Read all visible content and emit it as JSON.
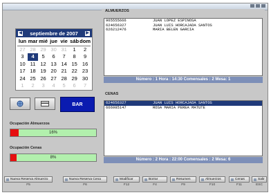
{
  "calendar": {
    "month_year": "septiembre de 2007",
    "prev_icon": "chevron-left-icon",
    "next_icon": "chevron-right-icon",
    "day_names": [
      "lun",
      "mar",
      "mié",
      "jue",
      "vie",
      "sáb",
      "dom"
    ],
    "weeks": [
      [
        {
          "d": "27",
          "o": 1
        },
        {
          "d": "28",
          "o": 1
        },
        {
          "d": "29",
          "o": 1
        },
        {
          "d": "30",
          "o": 1
        },
        {
          "d": "31",
          "o": 1
        },
        {
          "d": "1",
          "o": 0
        },
        {
          "d": "2",
          "o": 0
        }
      ],
      [
        {
          "d": "3",
          "o": 0
        },
        {
          "d": "4",
          "o": 0,
          "today": 1
        },
        {
          "d": "5",
          "o": 0
        },
        {
          "d": "6",
          "o": 0
        },
        {
          "d": "7",
          "o": 0
        },
        {
          "d": "8",
          "o": 0
        },
        {
          "d": "9",
          "o": 0
        }
      ],
      [
        {
          "d": "10",
          "o": 0
        },
        {
          "d": "11",
          "o": 0
        },
        {
          "d": "12",
          "o": 0
        },
        {
          "d": "13",
          "o": 0
        },
        {
          "d": "14",
          "o": 0
        },
        {
          "d": "15",
          "o": 0
        },
        {
          "d": "16",
          "o": 0
        }
      ],
      [
        {
          "d": "17",
          "o": 0
        },
        {
          "d": "18",
          "o": 0
        },
        {
          "d": "19",
          "o": 0
        },
        {
          "d": "20",
          "o": 0
        },
        {
          "d": "21",
          "o": 0
        },
        {
          "d": "22",
          "o": 0
        },
        {
          "d": "23",
          "o": 0
        }
      ],
      [
        {
          "d": "24",
          "o": 0
        },
        {
          "d": "25",
          "o": 0
        },
        {
          "d": "26",
          "o": 0
        },
        {
          "d": "27",
          "o": 0
        },
        {
          "d": "28",
          "o": 0
        },
        {
          "d": "29",
          "o": 0
        },
        {
          "d": "30",
          "o": 0
        }
      ],
      [
        {
          "d": "1",
          "o": 1
        },
        {
          "d": "2",
          "o": 1
        },
        {
          "d": "3",
          "o": 1
        },
        {
          "d": "4",
          "o": 1
        },
        {
          "d": "5",
          "o": 1
        },
        {
          "d": "6",
          "o": 1
        },
        {
          "d": "7",
          "o": 1
        }
      ]
    ]
  },
  "actions": {
    "bar_label": "BAR"
  },
  "occupancy": {
    "lunch_label": "Ocupación Almuerzos",
    "lunch_value": "16%",
    "lunch_fraction": 0.16,
    "dinner_label": "Ocupación Cenas",
    "dinner_value": "8%",
    "dinner_fraction": 0.08,
    "fill_color": "#e61010",
    "track_color": "#b2f0ad"
  },
  "almuerzos": {
    "title": "ALMUERZOS",
    "rows": [
      {
        "phone": "965555666",
        "name": "JUAN LOPEZ ESPINOSA"
      },
      {
        "phone": "624656327",
        "name": "JUAN LUIS HORCAJADA SANTOS"
      },
      {
        "phone": "626212476",
        "name": "MARIA BELEN GARCIA"
      }
    ],
    "status": "Número : 1  Hora : 14:30  Comensales : 2  Mesa: 1"
  },
  "cenas": {
    "title": "CENAS",
    "rows": [
      {
        "phone": "624656327",
        "name": "JUAN LUIS HORCAJADA SANTOS",
        "selected": true
      },
      {
        "phone": "666985147",
        "name": "ROSA MARIA PEREA MATUTE",
        "selected": false
      }
    ],
    "status": "Número : 2  Hora : 22:00  Comensales : 2  Mesa: 6"
  },
  "toolbar": {
    "buttons": [
      {
        "label": "Nueva Reserva Almuerzo",
        "key": "F5"
      },
      {
        "label": "Nueva Reserva Cena",
        "key": "F6"
      },
      {
        "label": "Modificar",
        "key": "F12"
      },
      {
        "label": "Borrar",
        "key": "F4"
      },
      {
        "label": "Resumen",
        "key": "F9"
      },
      {
        "label": "Almuerzos",
        "key": "F10"
      },
      {
        "label": "Cenas",
        "key": "F11"
      },
      {
        "label": "Salir",
        "key": "ESC"
      }
    ]
  }
}
